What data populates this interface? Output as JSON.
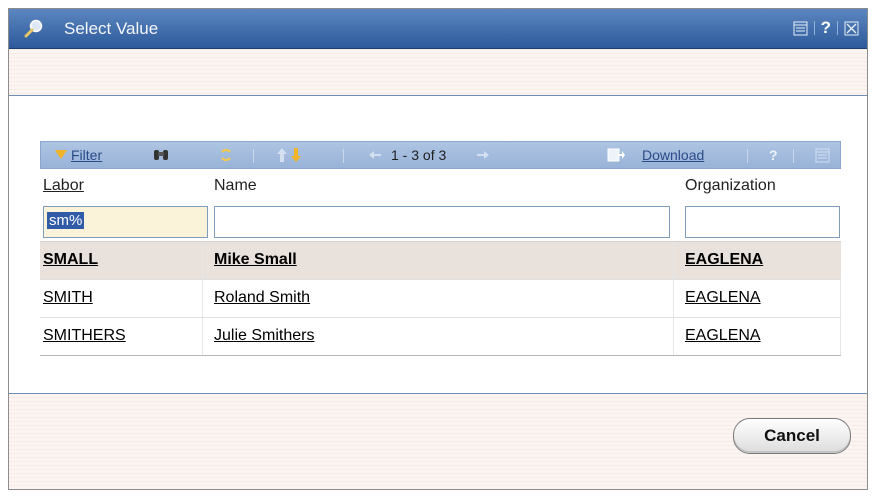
{
  "dialog": {
    "title": "Select Value",
    "title_icon": "magnifier-icon",
    "window_buttons": [
      "window-icon",
      "help-icon",
      "close-icon"
    ],
    "help_glyph": "?"
  },
  "toolbar": {
    "filter_label": "Filter",
    "paging_text": "1 - 3 of 3",
    "download_label": "Download",
    "help_glyph": "?"
  },
  "columns": {
    "labor": "Labor",
    "name": "Name",
    "organization": "Organization"
  },
  "filters": {
    "labor": "sm%",
    "name": "",
    "organization": ""
  },
  "rows": [
    {
      "labor": "SMALL",
      "name": "Mike Small",
      "organization": "EAGLENA",
      "selected": true
    },
    {
      "labor": "SMITH",
      "name": "Roland Smith",
      "organization": "EAGLENA",
      "selected": false
    },
    {
      "labor": "SMITHERS",
      "name": "Julie Smithers",
      "organization": "EAGLENA",
      "selected": false
    }
  ],
  "footer": {
    "cancel_label": "Cancel"
  },
  "colors": {
    "titlebar": "#2d5a9b",
    "toolbar": "#aec4e2",
    "selected_row": "#e8e1dc"
  }
}
